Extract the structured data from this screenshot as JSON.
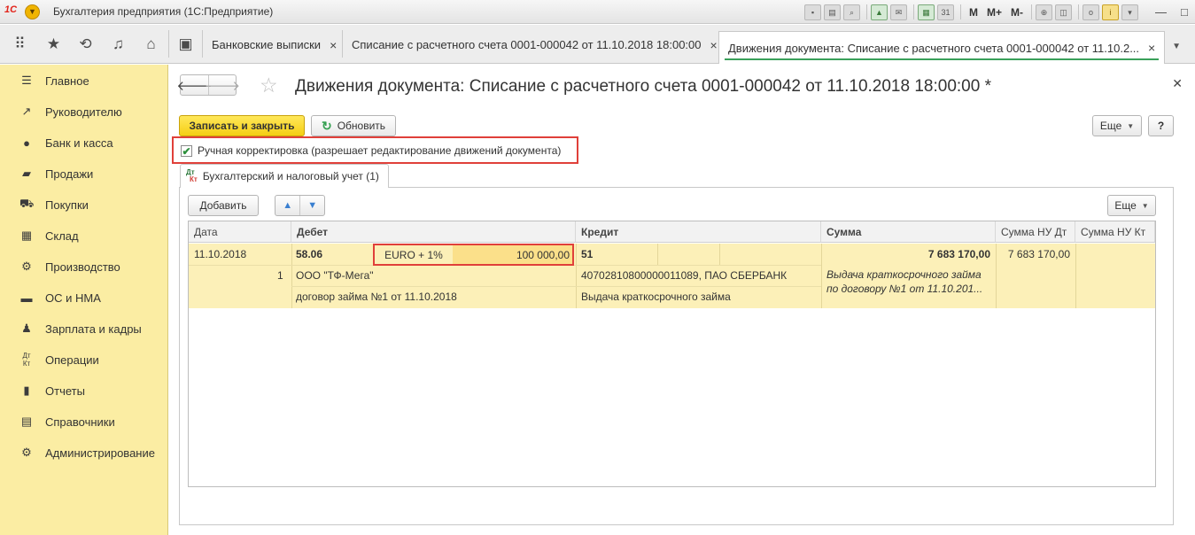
{
  "titlebar": {
    "logo": "1С",
    "app_title": "Бухгалтерия предприятия  (1С:Предприятие)",
    "m": "M",
    "m_plus": "M+",
    "m_minus": "M-"
  },
  "tabs": {
    "bank": "Банковские выписки",
    "writeoff": "Списание с расчетного счета 0001-000042 от 11.10.2018 18:00:00",
    "movements": "Движения документа: Списание с расчетного счета 0001-000042 от 11.10.2...",
    "close": "×"
  },
  "sidebar": {
    "items": [
      {
        "label": "Главное",
        "icon": "menu-icon"
      },
      {
        "label": "Руководителю",
        "icon": "trend-icon"
      },
      {
        "label": "Банк и касса",
        "icon": "coin-icon"
      },
      {
        "label": "Продажи",
        "icon": "bag-icon"
      },
      {
        "label": "Покупки",
        "icon": "cart-icon"
      },
      {
        "label": "Склад",
        "icon": "warehouse-icon"
      },
      {
        "label": "Производство",
        "icon": "factory-icon"
      },
      {
        "label": "ОС и НМА",
        "icon": "truck-icon"
      },
      {
        "label": "Зарплата и кадры",
        "icon": "person-icon"
      },
      {
        "label": "Операции",
        "icon": "dtkt-icon"
      },
      {
        "label": "Отчеты",
        "icon": "chart-icon"
      },
      {
        "label": "Справочники",
        "icon": "book-icon"
      },
      {
        "label": "Администрирование",
        "icon": "gear-icon"
      }
    ]
  },
  "form": {
    "title": "Движения документа: Списание с расчетного счета 0001-000042 от 11.10.2018 18:00:00 *",
    "save_close": "Записать и закрыть",
    "refresh": "Обновить",
    "more": "Еще",
    "help": "?",
    "manual_label": "Ручная корректировка (разрешает редактирование движений документа)",
    "manual_checked": true,
    "subtab_label": "Бухгалтерский и налоговый учет (1)",
    "add": "Добавить",
    "more2": "Еще"
  },
  "grid": {
    "headers": {
      "date": "Дата",
      "debit": "Дебет",
      "credit": "Кредит",
      "sum": "Сумма",
      "sum_nu_dt": "Сумма НУ Дт",
      "sum_nu_kt": "Сумма НУ Кт"
    },
    "row": {
      "date": "11.10.2018",
      "number": "1",
      "debit_account": "58.06",
      "debit_currency": "EURO + 1%",
      "debit_amount": "100 000,00",
      "debit_sub1": "ООО \"ТФ-Мега\"",
      "debit_sub2": "договор займа №1 от 11.10.2018",
      "credit_account": "51",
      "credit_sub1": "40702810800000011089, ПАО СБЕРБАНК",
      "credit_sub2": "Выдача краткосрочного займа",
      "sum": "7 683 170,00",
      "content_1": "Выдача краткосрочного займа",
      "content_2": "по договору №1 от 11.10.201...",
      "sum_nu_dt": "7 683 170,00"
    }
  }
}
